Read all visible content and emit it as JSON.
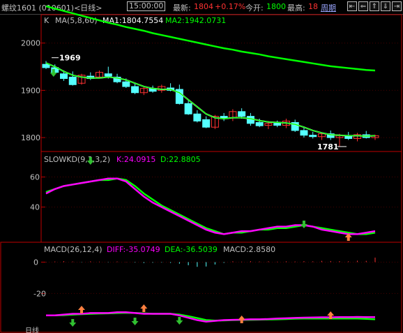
{
  "header": {
    "symbol": "螺纹1601 (010601)<日线>",
    "time": "15:00:00",
    "latest_label": "最新:",
    "latest_value": "1804",
    "change": "+0.17%",
    "open_label": "今开:",
    "open_value": "1800",
    "high_label": "最高:",
    "high_value": "18",
    "period_label": "周期"
  },
  "nav_buttons": [
    {
      "icon": "first-page-icon",
      "glyph": "⇤"
    },
    {
      "icon": "prev-page-icon",
      "glyph": "⇐"
    },
    {
      "icon": "up-icon",
      "glyph": "⇑"
    },
    {
      "icon": "down-icon",
      "glyph": "⇓"
    },
    {
      "icon": "next-icon",
      "glyph": "⇥"
    }
  ],
  "price_panel": {
    "legend_prefix": "K",
    "legend_ma": "MA(5,8,60)",
    "legend_ma1": "MA1:1804.7554",
    "legend_ma2": "MA2:1942.0731",
    "y_ticks": [
      "2000",
      "1900",
      "1800"
    ],
    "y_ticks_values": [
      2000,
      1900,
      1800
    ],
    "high_label": "1969",
    "low_label": "1781",
    "ylim": [
      1775,
      2035
    ]
  },
  "kd_panel": {
    "legend_name": "SLOWKD(9,3,3,2)",
    "legend_k": "K:24.0915",
    "legend_d": "D:22.8805",
    "y_ticks": [
      "60",
      "40"
    ],
    "y_ticks_values": [
      60,
      40
    ],
    "ylim": [
      18,
      70
    ]
  },
  "macd_panel": {
    "legend_name": "MACD(26,12,4)",
    "legend_diff": "DIFF:-35.0749",
    "legend_dea": "DEA:-36.5039",
    "legend_macd": "MACD:2.8580",
    "y_ticks": [
      "0",
      "-20"
    ],
    "y_ticks_values": [
      0,
      -20
    ],
    "ylim": [
      -43,
      6
    ]
  },
  "footer_text": "日线",
  "colors": {
    "up": "#ff3232",
    "down": "#54ffff",
    "ma1": "#ffffff",
    "ma2": "#00ff00",
    "k": "#ff00ff",
    "d": "#00ff00",
    "dea": "#00ff00",
    "diff": "#ff00ff",
    "grid": "#800000",
    "panel_border": "#c00000",
    "axis_text": "#c0c0c0"
  },
  "chart_data": [
    {
      "type": "candlestick",
      "title": "K MA(5,8,60)",
      "ylim": [
        1775,
        2035
      ],
      "candles": [
        {
          "o": 1955,
          "h": 1962,
          "l": 1945,
          "c": 1948,
          "dir": "down"
        },
        {
          "o": 1948,
          "h": 1955,
          "l": 1935,
          "c": 1938,
          "dir": "down"
        },
        {
          "o": 1935,
          "h": 1942,
          "l": 1920,
          "c": 1925,
          "dir": "down"
        },
        {
          "o": 1928,
          "h": 1940,
          "l": 1910,
          "c": 1912,
          "dir": "down"
        },
        {
          "o": 1915,
          "h": 1935,
          "l": 1912,
          "c": 1932,
          "dir": "up"
        },
        {
          "o": 1930,
          "h": 1938,
          "l": 1922,
          "c": 1925,
          "dir": "down"
        },
        {
          "o": 1928,
          "h": 1942,
          "l": 1925,
          "c": 1938,
          "dir": "up"
        },
        {
          "o": 1935,
          "h": 1950,
          "l": 1925,
          "c": 1930,
          "dir": "down"
        },
        {
          "o": 1928,
          "h": 1935,
          "l": 1915,
          "c": 1918,
          "dir": "down"
        },
        {
          "o": 1918,
          "h": 1925,
          "l": 1905,
          "c": 1908,
          "dir": "down"
        },
        {
          "o": 1908,
          "h": 1915,
          "l": 1892,
          "c": 1895,
          "dir": "down"
        },
        {
          "o": 1895,
          "h": 1908,
          "l": 1890,
          "c": 1904,
          "dir": "up"
        },
        {
          "o": 1904,
          "h": 1910,
          "l": 1895,
          "c": 1898,
          "dir": "down"
        },
        {
          "o": 1900,
          "h": 1912,
          "l": 1895,
          "c": 1908,
          "dir": "up"
        },
        {
          "o": 1905,
          "h": 1915,
          "l": 1898,
          "c": 1900,
          "dir": "down"
        },
        {
          "o": 1902,
          "h": 1912,
          "l": 1870,
          "c": 1872,
          "dir": "down"
        },
        {
          "o": 1872,
          "h": 1878,
          "l": 1848,
          "c": 1850,
          "dir": "down"
        },
        {
          "o": 1850,
          "h": 1858,
          "l": 1832,
          "c": 1835,
          "dir": "down"
        },
        {
          "o": 1838,
          "h": 1845,
          "l": 1820,
          "c": 1822,
          "dir": "down"
        },
        {
          "o": 1822,
          "h": 1848,
          "l": 1818,
          "c": 1845,
          "dir": "up"
        },
        {
          "o": 1845,
          "h": 1852,
          "l": 1835,
          "c": 1840,
          "dir": "down"
        },
        {
          "o": 1842,
          "h": 1860,
          "l": 1835,
          "c": 1855,
          "dir": "up"
        },
        {
          "o": 1855,
          "h": 1862,
          "l": 1840,
          "c": 1845,
          "dir": "down"
        },
        {
          "o": 1845,
          "h": 1852,
          "l": 1825,
          "c": 1830,
          "dir": "down"
        },
        {
          "o": 1832,
          "h": 1840,
          "l": 1822,
          "c": 1825,
          "dir": "down"
        },
        {
          "o": 1826,
          "h": 1835,
          "l": 1818,
          "c": 1830,
          "dir": "up"
        },
        {
          "o": 1830,
          "h": 1836,
          "l": 1822,
          "c": 1826,
          "dir": "down"
        },
        {
          "o": 1826,
          "h": 1840,
          "l": 1820,
          "c": 1835,
          "dir": "up"
        },
        {
          "o": 1832,
          "h": 1838,
          "l": 1812,
          "c": 1815,
          "dir": "down"
        },
        {
          "o": 1815,
          "h": 1822,
          "l": 1800,
          "c": 1805,
          "dir": "down"
        },
        {
          "o": 1805,
          "h": 1812,
          "l": 1798,
          "c": 1802,
          "dir": "down"
        },
        {
          "o": 1802,
          "h": 1810,
          "l": 1795,
          "c": 1808,
          "dir": "up"
        },
        {
          "o": 1808,
          "h": 1815,
          "l": 1795,
          "c": 1800,
          "dir": "down"
        },
        {
          "o": 1800,
          "h": 1808,
          "l": 1781,
          "c": 1804,
          "dir": "up"
        },
        {
          "o": 1804,
          "h": 1812,
          "l": 1795,
          "c": 1798,
          "dir": "down"
        },
        {
          "o": 1798,
          "h": 1810,
          "l": 1792,
          "c": 1806,
          "dir": "up"
        },
        {
          "o": 1806,
          "h": 1814,
          "l": 1798,
          "c": 1800,
          "dir": "down"
        },
        {
          "o": 1800,
          "h": 1806,
          "l": 1795,
          "c": 1804,
          "dir": "up"
        }
      ],
      "ma1": [
        1958,
        1950,
        1940,
        1932,
        1928,
        1926,
        1926,
        1928,
        1926,
        1922,
        1915,
        1908,
        1904,
        1902,
        1902,
        1895,
        1880,
        1865,
        1850,
        1842,
        1840,
        1842,
        1842,
        1840,
        1836,
        1833,
        1832,
        1831,
        1828,
        1822,
        1815,
        1810,
        1806,
        1805,
        1804,
        1804,
        1803,
        1804
      ],
      "ma2": [
        2078,
        2073,
        2068,
        2063,
        2058,
        2053,
        2048,
        2043,
        2039,
        2034,
        2030,
        2026,
        2021,
        2017,
        2013,
        2009,
        2005,
        2001,
        1997,
        1993,
        1989,
        1986,
        1982,
        1979,
        1976,
        1972,
        1969,
        1966,
        1963,
        1960,
        1957,
        1954,
        1951,
        1949,
        1947,
        1945,
        1943,
        1942
      ]
    },
    {
      "type": "line",
      "title": "SLOWKD(9,3,3,2)",
      "ylim": [
        18,
        70
      ],
      "series": [
        {
          "name": "K",
          "values": [
            49,
            52,
            54,
            55,
            56,
            57,
            58,
            59,
            59,
            57,
            52,
            47,
            43,
            40,
            37,
            34,
            31,
            28,
            25,
            23,
            22,
            23,
            24,
            24,
            25,
            26,
            27,
            27,
            28,
            28,
            27,
            25,
            24,
            23,
            22,
            22,
            23,
            24
          ]
        },
        {
          "name": "D",
          "values": [
            50,
            52,
            54,
            55,
            56,
            57,
            58,
            58,
            59,
            58,
            54,
            49,
            45,
            41,
            38,
            35,
            32,
            29,
            26,
            24,
            22,
            23,
            23,
            24,
            25,
            25,
            26,
            26,
            27,
            28,
            27,
            26,
            25,
            24,
            23,
            22,
            22,
            23
          ]
        }
      ]
    },
    {
      "type": "line",
      "title": "MACD(26,12,4)",
      "ylim": [
        -43,
        6
      ],
      "series": [
        {
          "name": "DIFF",
          "values": [
            -34,
            -34,
            -33.5,
            -33,
            -33,
            -32.5,
            -32.5,
            -32.5,
            -32,
            -32,
            -32.5,
            -33,
            -33,
            -33,
            -33,
            -34,
            -35.5,
            -37,
            -38,
            -37.5,
            -37,
            -36.8,
            -36.7,
            -36.5,
            -36.5,
            -36.3,
            -36,
            -35.8,
            -35.6,
            -35.4,
            -35.3,
            -35.2,
            -35.2,
            -35.1,
            -35.1,
            -35.0,
            -35.1,
            -35.07
          ]
        },
        {
          "name": "DEA",
          "values": [
            -34,
            -34,
            -33.8,
            -33.5,
            -33.2,
            -33,
            -32.8,
            -32.7,
            -32.5,
            -32.3,
            -32.4,
            -32.7,
            -33,
            -33,
            -33,
            -33.5,
            -34.5,
            -35.7,
            -37,
            -37.3,
            -37.2,
            -37,
            -36.9,
            -36.8,
            -36.7,
            -36.6,
            -36.5,
            -36.3,
            -36.1,
            -36,
            -36,
            -36,
            -36,
            -36,
            -36,
            -36,
            -36.2,
            -36.5
          ]
        },
        {
          "name": "MACD",
          "values": [
            0.2,
            0.4,
            0.6,
            0.4,
            -0.2,
            0.5,
            0.3,
            -0.2,
            0.4,
            0.2,
            -0.3,
            -0.6,
            -0.4,
            -0.3,
            -0.5,
            -1,
            -2,
            -3,
            -2.8,
            -1.5,
            -0.5,
            0.5,
            0.3,
            0.6,
            0.4,
            0.5,
            0.3,
            0.5,
            0.4,
            0.6,
            0.5,
            0.8,
            0.7,
            0.6,
            0.5,
            0.9,
            0.8,
            2.9
          ]
        }
      ]
    }
  ]
}
